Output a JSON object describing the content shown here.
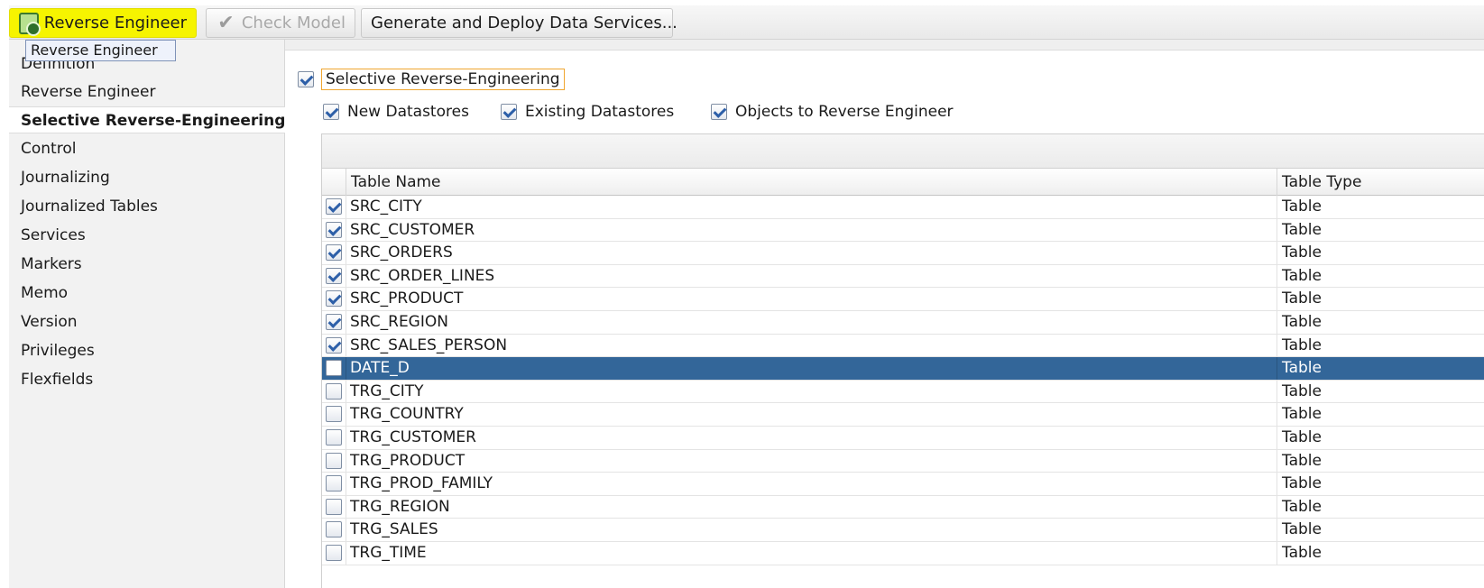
{
  "toolbar": {
    "reverse_engineer_label": "Reverse Engineer",
    "check_model_label": "Check Model",
    "generate_label": "Generate and Deploy Data Services...",
    "reverse_engineer_highlight": "#f6f400",
    "tooltip": "Reverse Engineer"
  },
  "nav": {
    "items": [
      {
        "label": "Definition"
      },
      {
        "label": "Reverse Engineer"
      },
      {
        "label": "Selective Reverse-Engineering"
      },
      {
        "label": "Control"
      },
      {
        "label": "Journalizing"
      },
      {
        "label": "Journalized Tables"
      },
      {
        "label": "Services"
      },
      {
        "label": "Markers"
      },
      {
        "label": "Memo"
      },
      {
        "label": "Version"
      },
      {
        "label": "Privileges"
      },
      {
        "label": "Flexfields"
      }
    ],
    "active_index": 2
  },
  "selective": {
    "label": "Selective Reverse-Engineering",
    "checked": true
  },
  "options": {
    "new_datastores": {
      "label": "New Datastores",
      "checked": true
    },
    "existing_datastores": {
      "label": "Existing Datastores",
      "checked": true
    },
    "objects_to_reverse": {
      "label": "Objects to Reverse Engineer",
      "checked": true
    }
  },
  "table": {
    "columns": {
      "name": "Table Name",
      "type": "Table Type"
    },
    "selected_row_color": "#336699",
    "rows": [
      {
        "name": "SRC_CITY",
        "type": "Table",
        "checked": true,
        "selected": false
      },
      {
        "name": "SRC_CUSTOMER",
        "type": "Table",
        "checked": true,
        "selected": false
      },
      {
        "name": "SRC_ORDERS",
        "type": "Table",
        "checked": true,
        "selected": false
      },
      {
        "name": "SRC_ORDER_LINES",
        "type": "Table",
        "checked": true,
        "selected": false
      },
      {
        "name": "SRC_PRODUCT",
        "type": "Table",
        "checked": true,
        "selected": false
      },
      {
        "name": "SRC_REGION",
        "type": "Table",
        "checked": true,
        "selected": false
      },
      {
        "name": "SRC_SALES_PERSON",
        "type": "Table",
        "checked": true,
        "selected": false
      },
      {
        "name": "DATE_D",
        "type": "Table",
        "checked": false,
        "selected": true
      },
      {
        "name": "TRG_CITY",
        "type": "Table",
        "checked": false,
        "selected": false
      },
      {
        "name": "TRG_COUNTRY",
        "type": "Table",
        "checked": false,
        "selected": false
      },
      {
        "name": "TRG_CUSTOMER",
        "type": "Table",
        "checked": false,
        "selected": false
      },
      {
        "name": "TRG_PRODUCT",
        "type": "Table",
        "checked": false,
        "selected": false
      },
      {
        "name": "TRG_PROD_FAMILY",
        "type": "Table",
        "checked": false,
        "selected": false
      },
      {
        "name": "TRG_REGION",
        "type": "Table",
        "checked": false,
        "selected": false
      },
      {
        "name": "TRG_SALES",
        "type": "Table",
        "checked": false,
        "selected": false
      },
      {
        "name": "TRG_TIME",
        "type": "Table",
        "checked": false,
        "selected": false
      }
    ]
  }
}
